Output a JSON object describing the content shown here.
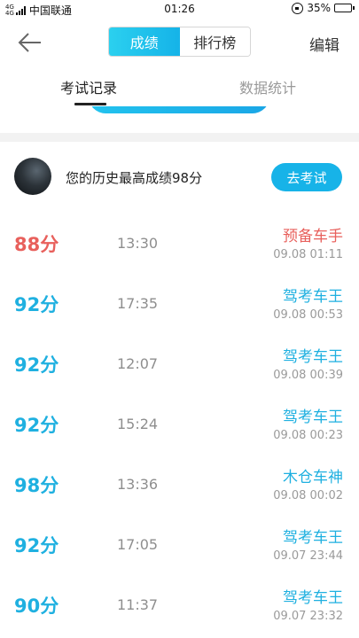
{
  "status_bar": {
    "network": "4G",
    "network_sub": "4G",
    "carrier": "中国联通",
    "time": "01:26",
    "battery": "35%",
    "battery_level": 0.35
  },
  "nav": {
    "segments": [
      "成绩",
      "排行榜"
    ],
    "active_segment": 0,
    "edit_label": "编辑"
  },
  "tabs": {
    "items": [
      "考试记录",
      "数据统计"
    ],
    "active": 0
  },
  "best": {
    "text": "您的历史最高成绩98分",
    "button_label": "去考试"
  },
  "records": [
    {
      "score": "88分",
      "duration": "13:30",
      "rank": "预备车手",
      "date": "09.08  01:11",
      "color": "#e8605c"
    },
    {
      "score": "92分",
      "duration": "17:35",
      "rank": "驾考车王",
      "date": "09.08  00:53",
      "color": "#1fb0e0"
    },
    {
      "score": "92分",
      "duration": "12:07",
      "rank": "驾考车王",
      "date": "09.08  00:39",
      "color": "#1fb0e0"
    },
    {
      "score": "92分",
      "duration": "15:24",
      "rank": "驾考车王",
      "date": "09.08  00:23",
      "color": "#1fb0e0"
    },
    {
      "score": "98分",
      "duration": "13:36",
      "rank": "木仓车神",
      "date": "09.08  00:02",
      "color": "#1fb0e0"
    },
    {
      "score": "92分",
      "duration": "17:05",
      "rank": "驾考车王",
      "date": "09.07  23:44",
      "color": "#1fb0e0"
    },
    {
      "score": "90分",
      "duration": "11:37",
      "rank": "驾考车王",
      "date": "09.07  23:32",
      "color": "#1fb0e0"
    }
  ],
  "colors": {
    "accent": "#17b3e8",
    "fail": "#e8605c",
    "pass": "#1fb0e0"
  }
}
